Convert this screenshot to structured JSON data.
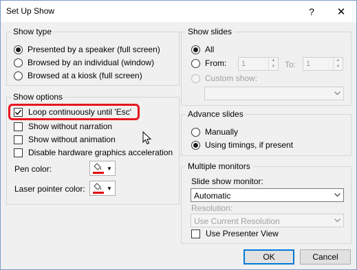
{
  "window": {
    "title": "Set Up Show",
    "help_label": "?",
    "close_label": "✕"
  },
  "show_type": {
    "legend": "Show type",
    "options": [
      {
        "label": "Presented by a speaker (full screen)",
        "selected": true
      },
      {
        "label": "Browsed by an individual (window)",
        "selected": false
      },
      {
        "label": "Browsed at a kiosk (full screen)",
        "selected": false
      }
    ]
  },
  "show_options": {
    "legend": "Show options",
    "checkboxes": [
      {
        "label": "Loop continuously until 'Esc'",
        "checked": true
      },
      {
        "label": "Show without narration",
        "checked": false
      },
      {
        "label": "Show without animation",
        "checked": false
      },
      {
        "label": "Disable hardware graphics acceleration",
        "checked": false
      }
    ],
    "pen_color_label": "Pen color:",
    "laser_pointer_label": "Laser pointer color:",
    "pen_color": "#e00000",
    "laser_color": "#e00000"
  },
  "show_slides": {
    "legend": "Show slides",
    "all_label": "All",
    "all_selected": true,
    "from_label": "From:",
    "from_value": "1",
    "to_label": "To:",
    "to_value": "1",
    "custom_label": "Custom show:",
    "custom_value": ""
  },
  "advance_slides": {
    "legend": "Advance slides",
    "options": [
      {
        "label": "Manually",
        "selected": false
      },
      {
        "label": "Using timings, if present",
        "selected": true
      }
    ]
  },
  "multiple_monitors": {
    "legend": "Multiple monitors",
    "monitor_label": "Slide show monitor:",
    "monitor_value": "Automatic",
    "resolution_label": "Resolution:",
    "resolution_value": "Use Current Resolution",
    "presenter_view_label": "Use Presenter View",
    "presenter_view_checked": false
  },
  "footer": {
    "ok_label": "OK",
    "cancel_label": "Cancel"
  },
  "colors": {
    "highlight": "#e8141e",
    "accent": "#0078d7"
  }
}
